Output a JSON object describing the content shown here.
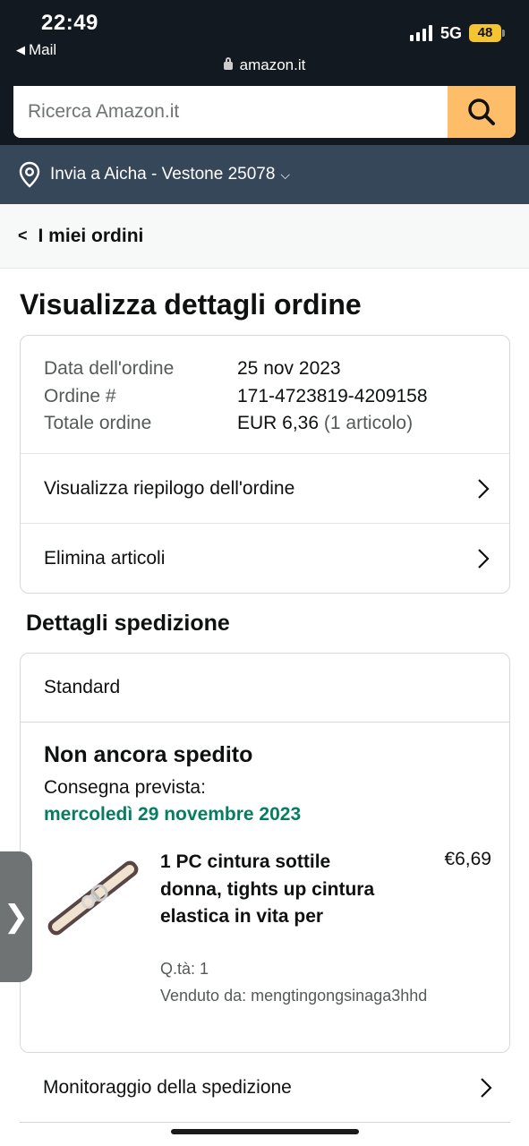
{
  "status_bar": {
    "time": "22:49",
    "back_app": "Mail",
    "network": "5G",
    "battery": "48",
    "url": "amazon.it"
  },
  "search": {
    "placeholder": "Ricerca Amazon.it",
    "value": ""
  },
  "delivery": {
    "label": "Invia a Aicha - Vestone 25078"
  },
  "breadcrumb": {
    "label": "I miei ordini"
  },
  "page": {
    "title": "Visualizza dettagli ordine"
  },
  "order": {
    "date_label": "Data dell'ordine",
    "date_value": "25 nov 2023",
    "number_label": "Ordine #",
    "number_value": "171-4723819-4209158",
    "total_label": "Totale ordine",
    "total_value": "EUR 6,36",
    "total_items": "(1 articolo)"
  },
  "links": {
    "summary": "Visualizza riepilogo dell'ordine",
    "delete": "Elimina articoli"
  },
  "shipping": {
    "section_title": "Dettagli spedizione",
    "method": "Standard",
    "status": "Non ancora spedito",
    "expected_label": "Consegna prevista:",
    "expected_date": "mercoledì 29 novembre 2023"
  },
  "item": {
    "title": "1 PC cintura sottile donna, tights up cintura elastica in vita per",
    "price": "€6,69",
    "qty": "Q.tà: 1",
    "seller": "Venduto da: mengtingongsinaga3hhd"
  },
  "tracking": {
    "label": "Monitoraggio della spedizione"
  },
  "colors": {
    "header": "#131921",
    "search_button": "#febd69",
    "delivery_bar": "#37475a",
    "delivery_date": "#067d62"
  },
  "icons": [
    "mail-back-icon",
    "signal-icon",
    "battery-icon",
    "lock-icon",
    "search-icon",
    "location-pin-icon",
    "chevron-down-icon",
    "chevron-left-icon",
    "chevron-right-icon",
    "side-tab-icon"
  ]
}
